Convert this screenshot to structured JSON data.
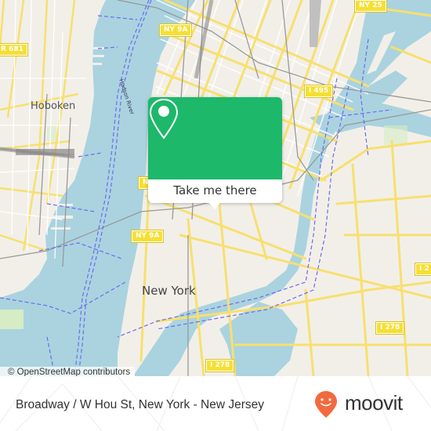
{
  "map": {
    "colors": {
      "water": "#aad3df",
      "land": "#f2efe9",
      "road_major": "#f7e06e",
      "road_minor": "#ffffff",
      "rail": "#999999",
      "ferry": "#6b6bf0",
      "park": "#d5ecc5",
      "shield": "#f6df32"
    },
    "place_labels": {
      "hoboken": "Hoboken",
      "new_york": "New York",
      "hudson_river": "Hudson River"
    },
    "road_shields": {
      "cr681": "R 681",
      "ny9a_top": "NY 9A",
      "ny9a_mid": "NY 9A",
      "ny9a_small": "N",
      "ny25": "NY 25",
      "i495": "I 495",
      "i278_right": "I 2",
      "i278_mid": "I 278",
      "i278_bottom": "I 278"
    },
    "attribution": "© OpenStreetMap contributors"
  },
  "popup": {
    "accent": "#1db86a",
    "icon": "location-pin-icon",
    "button_label": "Take me there"
  },
  "footer": {
    "title": "Broadway / W Hou St, New York - New Jersey",
    "brand": "moovit",
    "brand_color": "#f26a3d"
  }
}
